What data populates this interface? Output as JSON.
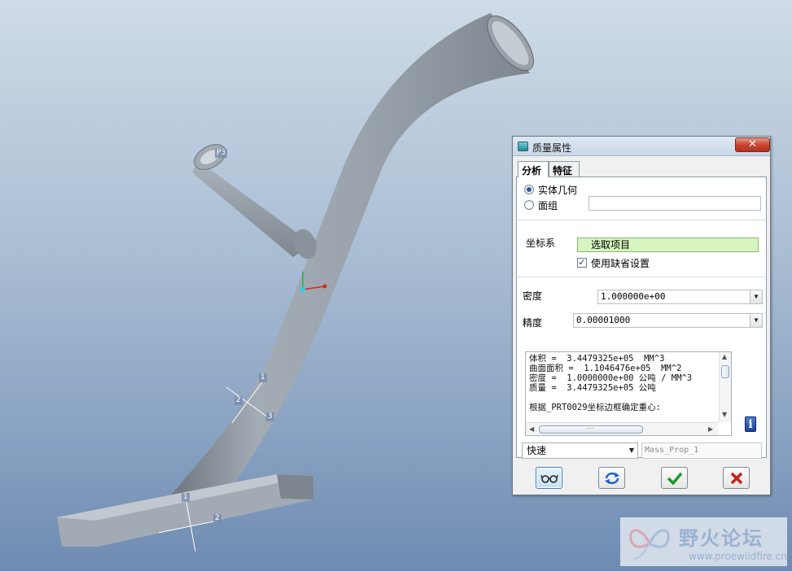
{
  "viewport": {
    "labels": {
      "point": "P3",
      "csys_top": "1",
      "csys_mid": "2",
      "csys_low": "3",
      "base_a": "1",
      "base_b": "2"
    }
  },
  "dialog": {
    "title": "质量属性",
    "close_label": "✕",
    "tabs": [
      "分析",
      "特征"
    ],
    "radio_solid": "实体几何",
    "radio_quilt": "面组",
    "coord_label": "坐标系",
    "coord_select": "选取项目",
    "use_default_label": "使用缺省设置",
    "density_label": "密度",
    "density_value": "1.000000e+00",
    "precision_label": "精度",
    "precision_value": "0.00001000",
    "results": [
      "体积 =  3.4479325e+05  MM^3",
      "曲面面积 =  1.1046476e+05  MM^2",
      "密度 =  1.0000000e+00 公吨 / MM^3",
      "质量 =  3.4479325e+05 公吨",
      "",
      "根据_PRT0029坐标边框确定重心:"
    ],
    "mode_value": "快速",
    "name_value": "Mass_Prop_1",
    "info_icon": "i"
  },
  "watermark": {
    "title": "野火论坛",
    "url": "www.proewildfire.cn"
  }
}
